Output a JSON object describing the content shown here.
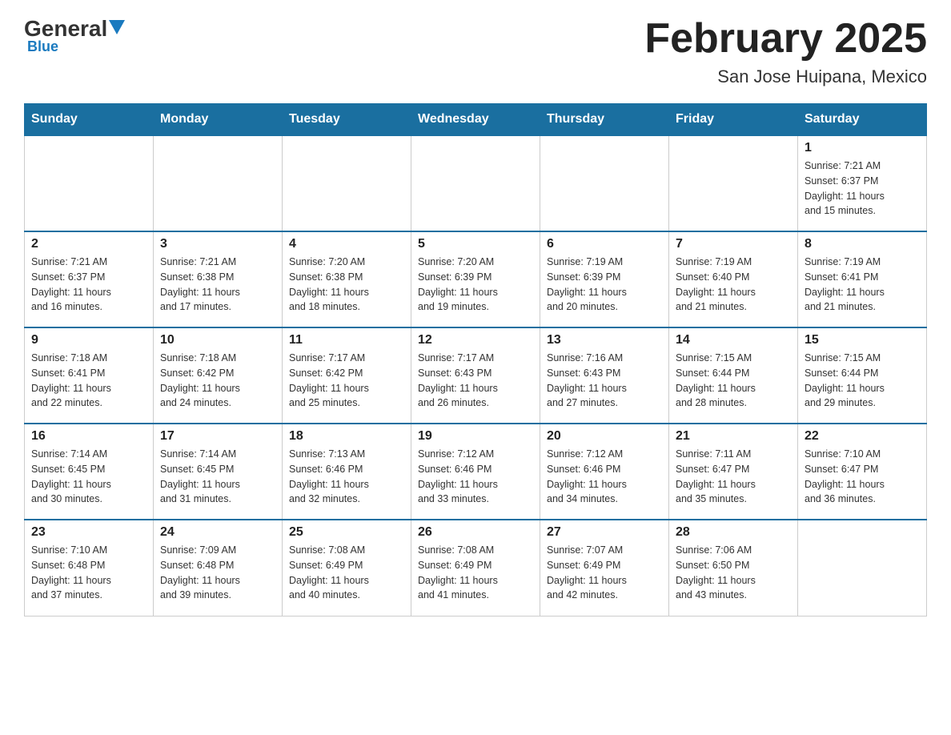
{
  "header": {
    "logo": {
      "general": "General",
      "blue": "Blue"
    },
    "title": "February 2025",
    "location": "San Jose Huipana, Mexico"
  },
  "weekdays": [
    "Sunday",
    "Monday",
    "Tuesday",
    "Wednesday",
    "Thursday",
    "Friday",
    "Saturday"
  ],
  "weeks": [
    [
      {
        "day": "",
        "info": ""
      },
      {
        "day": "",
        "info": ""
      },
      {
        "day": "",
        "info": ""
      },
      {
        "day": "",
        "info": ""
      },
      {
        "day": "",
        "info": ""
      },
      {
        "day": "",
        "info": ""
      },
      {
        "day": "1",
        "info": "Sunrise: 7:21 AM\nSunset: 6:37 PM\nDaylight: 11 hours\nand 15 minutes."
      }
    ],
    [
      {
        "day": "2",
        "info": "Sunrise: 7:21 AM\nSunset: 6:37 PM\nDaylight: 11 hours\nand 16 minutes."
      },
      {
        "day": "3",
        "info": "Sunrise: 7:21 AM\nSunset: 6:38 PM\nDaylight: 11 hours\nand 17 minutes."
      },
      {
        "day": "4",
        "info": "Sunrise: 7:20 AM\nSunset: 6:38 PM\nDaylight: 11 hours\nand 18 minutes."
      },
      {
        "day": "5",
        "info": "Sunrise: 7:20 AM\nSunset: 6:39 PM\nDaylight: 11 hours\nand 19 minutes."
      },
      {
        "day": "6",
        "info": "Sunrise: 7:19 AM\nSunset: 6:39 PM\nDaylight: 11 hours\nand 20 minutes."
      },
      {
        "day": "7",
        "info": "Sunrise: 7:19 AM\nSunset: 6:40 PM\nDaylight: 11 hours\nand 21 minutes."
      },
      {
        "day": "8",
        "info": "Sunrise: 7:19 AM\nSunset: 6:41 PM\nDaylight: 11 hours\nand 21 minutes."
      }
    ],
    [
      {
        "day": "9",
        "info": "Sunrise: 7:18 AM\nSunset: 6:41 PM\nDaylight: 11 hours\nand 22 minutes."
      },
      {
        "day": "10",
        "info": "Sunrise: 7:18 AM\nSunset: 6:42 PM\nDaylight: 11 hours\nand 24 minutes."
      },
      {
        "day": "11",
        "info": "Sunrise: 7:17 AM\nSunset: 6:42 PM\nDaylight: 11 hours\nand 25 minutes."
      },
      {
        "day": "12",
        "info": "Sunrise: 7:17 AM\nSunset: 6:43 PM\nDaylight: 11 hours\nand 26 minutes."
      },
      {
        "day": "13",
        "info": "Sunrise: 7:16 AM\nSunset: 6:43 PM\nDaylight: 11 hours\nand 27 minutes."
      },
      {
        "day": "14",
        "info": "Sunrise: 7:15 AM\nSunset: 6:44 PM\nDaylight: 11 hours\nand 28 minutes."
      },
      {
        "day": "15",
        "info": "Sunrise: 7:15 AM\nSunset: 6:44 PM\nDaylight: 11 hours\nand 29 minutes."
      }
    ],
    [
      {
        "day": "16",
        "info": "Sunrise: 7:14 AM\nSunset: 6:45 PM\nDaylight: 11 hours\nand 30 minutes."
      },
      {
        "day": "17",
        "info": "Sunrise: 7:14 AM\nSunset: 6:45 PM\nDaylight: 11 hours\nand 31 minutes."
      },
      {
        "day": "18",
        "info": "Sunrise: 7:13 AM\nSunset: 6:46 PM\nDaylight: 11 hours\nand 32 minutes."
      },
      {
        "day": "19",
        "info": "Sunrise: 7:12 AM\nSunset: 6:46 PM\nDaylight: 11 hours\nand 33 minutes."
      },
      {
        "day": "20",
        "info": "Sunrise: 7:12 AM\nSunset: 6:46 PM\nDaylight: 11 hours\nand 34 minutes."
      },
      {
        "day": "21",
        "info": "Sunrise: 7:11 AM\nSunset: 6:47 PM\nDaylight: 11 hours\nand 35 minutes."
      },
      {
        "day": "22",
        "info": "Sunrise: 7:10 AM\nSunset: 6:47 PM\nDaylight: 11 hours\nand 36 minutes."
      }
    ],
    [
      {
        "day": "23",
        "info": "Sunrise: 7:10 AM\nSunset: 6:48 PM\nDaylight: 11 hours\nand 37 minutes."
      },
      {
        "day": "24",
        "info": "Sunrise: 7:09 AM\nSunset: 6:48 PM\nDaylight: 11 hours\nand 39 minutes."
      },
      {
        "day": "25",
        "info": "Sunrise: 7:08 AM\nSunset: 6:49 PM\nDaylight: 11 hours\nand 40 minutes."
      },
      {
        "day": "26",
        "info": "Sunrise: 7:08 AM\nSunset: 6:49 PM\nDaylight: 11 hours\nand 41 minutes."
      },
      {
        "day": "27",
        "info": "Sunrise: 7:07 AM\nSunset: 6:49 PM\nDaylight: 11 hours\nand 42 minutes."
      },
      {
        "day": "28",
        "info": "Sunrise: 7:06 AM\nSunset: 6:50 PM\nDaylight: 11 hours\nand 43 minutes."
      },
      {
        "day": "",
        "info": ""
      }
    ]
  ]
}
